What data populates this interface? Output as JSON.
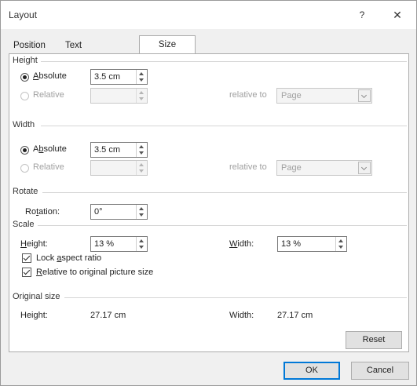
{
  "window": {
    "title": "Layout",
    "help": "?",
    "close": "✕"
  },
  "tabs": [
    {
      "label": "Position"
    },
    {
      "label": "Text Wrapping"
    },
    {
      "label": "Size"
    }
  ],
  "height_section": {
    "title": "Height",
    "absolute_label": "Absolute",
    "absolute_value": "3.5 cm",
    "relative_label": "Relative",
    "relative_value": "",
    "relative_to_label": "relative to",
    "relative_to_value": "Page"
  },
  "width_section": {
    "title": "Width",
    "absolute_label": "Absolute",
    "absolute_value": "3.5 cm",
    "relative_label": "Relative",
    "relative_value": "",
    "relative_to_label": "relative to",
    "relative_to_value": "Page"
  },
  "rotate_section": {
    "title": "Rotate",
    "rotation_label": "Rotation:",
    "rotation_value": "0°"
  },
  "scale_section": {
    "title": "Scale",
    "height_label": "Height:",
    "height_value": "13 %",
    "width_label": "Width:",
    "width_value": "13 %",
    "lock_aspect_label": "Lock aspect ratio",
    "relative_original_label": "Relative to original picture size"
  },
  "original_section": {
    "title": "Original size",
    "height_label": "Height:",
    "height_value": "27.17 cm",
    "width_label": "Width:",
    "width_value": "27.17 cm"
  },
  "buttons": {
    "reset": "Reset",
    "ok": "OK",
    "cancel": "Cancel"
  }
}
